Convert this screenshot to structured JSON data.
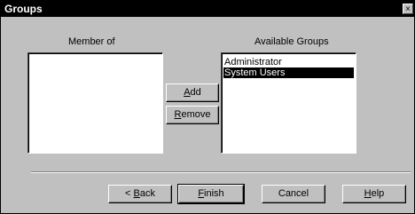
{
  "window": {
    "title": "Groups",
    "close_glyph": "×"
  },
  "member_of": {
    "label": "Member of",
    "items": []
  },
  "available_groups": {
    "label": "Available Groups",
    "items": [
      "Administrator",
      "System Users"
    ],
    "selected": "System Users"
  },
  "buttons": {
    "add": {
      "mnemonic": "A",
      "rest": "dd"
    },
    "remove": {
      "mnemonic": "R",
      "rest": "emove"
    },
    "back": {
      "prefix": "< ",
      "mnemonic": "B",
      "rest": "ack"
    },
    "finish": {
      "mnemonic": "F",
      "rest": "inish"
    },
    "cancel": {
      "label": "Cancel"
    },
    "help": {
      "mnemonic": "H",
      "rest": "elp"
    }
  }
}
